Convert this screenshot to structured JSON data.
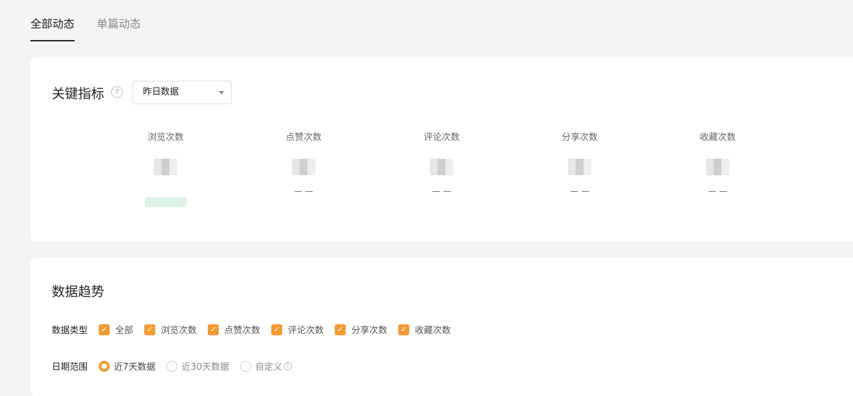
{
  "tabs": [
    {
      "label": "全部动态",
      "active": true
    },
    {
      "label": "单篇动态",
      "active": false
    }
  ],
  "key_metrics": {
    "title": "关键指标",
    "help_icon": "question-circle-icon",
    "select": {
      "value": "昨日数据"
    },
    "items": [
      {
        "label": "浏览次数",
        "change": ""
      },
      {
        "label": "点赞次数",
        "change": "— —"
      },
      {
        "label": "评论次数",
        "change": "— —"
      },
      {
        "label": "分享次数",
        "change": "— —"
      },
      {
        "label": "收藏次数",
        "change": "— —"
      }
    ]
  },
  "trend": {
    "title": "数据趋势",
    "type_label": "数据类型",
    "types": [
      "全部",
      "浏览次数",
      "点赞次数",
      "评论次数",
      "分享次数",
      "收藏次数"
    ],
    "date_label": "日期范围",
    "date_options": [
      "近7天数据",
      "近30天数据",
      "自定义"
    ],
    "accent_color": "#f29a34"
  }
}
